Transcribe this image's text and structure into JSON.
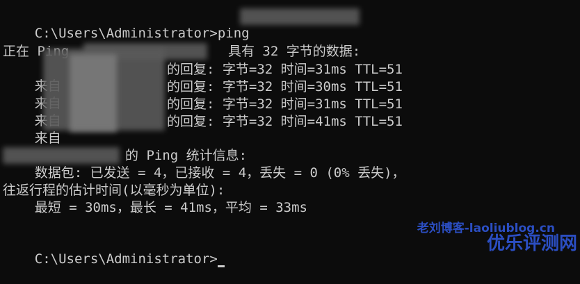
{
  "terminal": {
    "prompt_first": "C:\\Users\\Administrator>ping",
    "ping_header": "正在 Ping                    具有 32 字节的数据:",
    "replies": [
      {
        "prefix": "来自",
        "rest": "的回复: 字节=32 时间=31ms TTL=51"
      },
      {
        "prefix": "来自",
        "rest": "的回复: 字节=32 时间=30ms TTL=51"
      },
      {
        "prefix": "来自",
        "rest": "的回复: 字节=32 时间=31ms TTL=51"
      },
      {
        "prefix": "来自",
        "rest": "的回复: 字节=32 时间=41ms TTL=51"
      }
    ],
    "stats_header": "的 Ping 统计信息:",
    "packets_line": "    数据包: 已发送 = 4，已接收 = 4，丢失 = 0 (0% 丢失)，",
    "rtt_header": "往返行程的估计时间(以毫秒为单位):",
    "rtt_line": "    最短 = 30ms，最长 = 41ms，平均 = 33ms",
    "prompt_last": "C:\\Users\\Administrator>"
  },
  "watermark": {
    "line1": "老刘博客-laoliublog.cn",
    "line2": "优乐评测网"
  },
  "colors": {
    "background": "#0c0c0c",
    "text": "#cccccc",
    "watermark": "#2f56d6"
  }
}
